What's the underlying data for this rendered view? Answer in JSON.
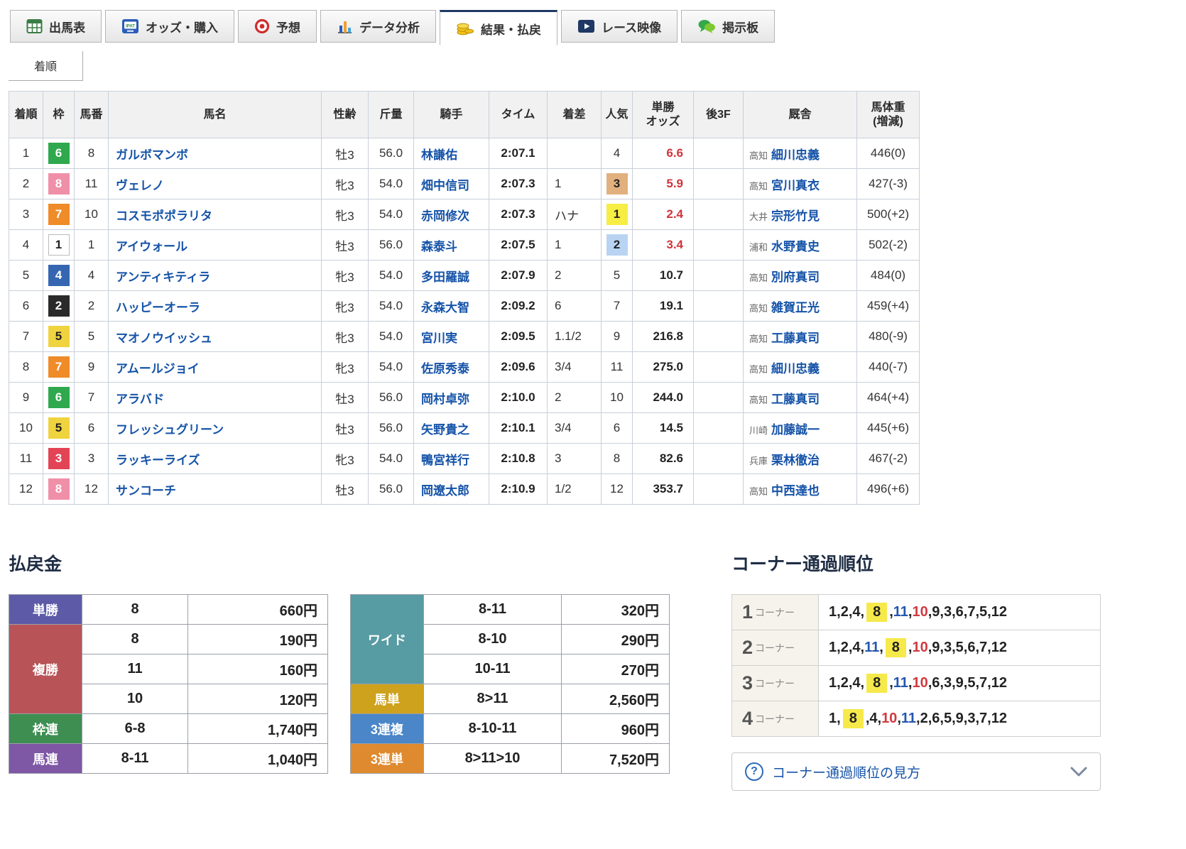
{
  "tabs": [
    {
      "id": "shutsubahyo",
      "label": "出馬表",
      "icon": "racecard-table-icon",
      "active": false
    },
    {
      "id": "odds",
      "label": "オッズ・購入",
      "icon": "ipat-odds-icon",
      "active": false
    },
    {
      "id": "yoso",
      "label": "予想",
      "icon": "prediction-target-icon",
      "active": false
    },
    {
      "id": "data",
      "label": "データ分析",
      "icon": "data-analysis-chart-icon",
      "active": false
    },
    {
      "id": "kekka",
      "label": "結果・払戻",
      "icon": "result-payout-coins-icon",
      "active": true
    },
    {
      "id": "video",
      "label": "レース映像",
      "icon": "race-video-icon",
      "active": false
    },
    {
      "id": "keijiban",
      "label": "掲示板",
      "icon": "bbs-comment-icon",
      "active": false
    }
  ],
  "subtab": {
    "label": "着順"
  },
  "results": {
    "headers": [
      "着順",
      "枠",
      "馬番",
      "馬名",
      "性齢",
      "斤量",
      "騎手",
      "タイム",
      "着差",
      "人気",
      "単勝\nオッズ",
      "後3F",
      "厩舎",
      "馬体重\n(増減)"
    ],
    "colors": {
      "frame": {
        "1": "#ffffff",
        "2": "#2b2b2b",
        "3": "#e24456",
        "4": "#3566b2",
        "5": "#efd33f",
        "6": "#2fa84e",
        "7": "#ef8b28",
        "8": "#f08fa8"
      },
      "pop": {
        "1": "#f6ee44",
        "2": "#b9d3f2",
        "3": "#e2b07e"
      },
      "odds_hot": "#d0343c",
      "link": "#1553a8"
    },
    "rows": [
      {
        "rank": "1",
        "frame": "6",
        "no": "8",
        "horse": "ガルボマンボ",
        "sex_age": "牡3",
        "weight": "56.0",
        "jockey": "林謙佑",
        "time": "2:07.1",
        "margin": "",
        "pop": "4",
        "odds": "6.6",
        "odds_hot": true,
        "last3f": "",
        "region": "高知",
        "trainer": "細川忠義",
        "horse_weight": "446(0)"
      },
      {
        "rank": "2",
        "frame": "8",
        "no": "11",
        "horse": "ヴェレノ",
        "sex_age": "牝3",
        "weight": "54.0",
        "jockey": "畑中信司",
        "time": "2:07.3",
        "margin": "1",
        "pop": "3",
        "odds": "5.9",
        "odds_hot": true,
        "last3f": "",
        "region": "高知",
        "trainer": "宮川真衣",
        "horse_weight": "427(-3)"
      },
      {
        "rank": "3",
        "frame": "7",
        "no": "10",
        "horse": "コスモポポラリタ",
        "sex_age": "牝3",
        "weight": "54.0",
        "jockey": "赤岡修次",
        "time": "2:07.3",
        "margin": "ハナ",
        "pop": "1",
        "odds": "2.4",
        "odds_hot": true,
        "last3f": "",
        "region": "大井",
        "trainer": "宗形竹見",
        "horse_weight": "500(+2)"
      },
      {
        "rank": "4",
        "frame": "1",
        "no": "1",
        "horse": "アイウォール",
        "sex_age": "牡3",
        "weight": "56.0",
        "jockey": "森泰斗",
        "time": "2:07.5",
        "margin": "1",
        "pop": "2",
        "odds": "3.4",
        "odds_hot": true,
        "last3f": "",
        "region": "浦和",
        "trainer": "水野貴史",
        "horse_weight": "502(-2)"
      },
      {
        "rank": "5",
        "frame": "4",
        "no": "4",
        "horse": "アンティキティラ",
        "sex_age": "牝3",
        "weight": "54.0",
        "jockey": "多田羅誠",
        "time": "2:07.9",
        "margin": "2",
        "pop": "5",
        "odds": "10.7",
        "odds_hot": false,
        "last3f": "",
        "region": "高知",
        "trainer": "別府真司",
        "horse_weight": "484(0)"
      },
      {
        "rank": "6",
        "frame": "2",
        "no": "2",
        "horse": "ハッピーオーラ",
        "sex_age": "牝3",
        "weight": "54.0",
        "jockey": "永森大智",
        "time": "2:09.2",
        "margin": "6",
        "pop": "7",
        "odds": "19.1",
        "odds_hot": false,
        "last3f": "",
        "region": "高知",
        "trainer": "雑賀正光",
        "horse_weight": "459(+4)"
      },
      {
        "rank": "7",
        "frame": "5",
        "no": "5",
        "horse": "マオノウイッシュ",
        "sex_age": "牝3",
        "weight": "54.0",
        "jockey": "宮川実",
        "time": "2:09.5",
        "margin": "1.1/2",
        "pop": "9",
        "odds": "216.8",
        "odds_hot": false,
        "last3f": "",
        "region": "高知",
        "trainer": "工藤真司",
        "horse_weight": "480(-9)"
      },
      {
        "rank": "8",
        "frame": "7",
        "no": "9",
        "horse": "アムールジョイ",
        "sex_age": "牝3",
        "weight": "54.0",
        "jockey": "佐原秀泰",
        "time": "2:09.6",
        "margin": "3/4",
        "pop": "11",
        "odds": "275.0",
        "odds_hot": false,
        "last3f": "",
        "region": "高知",
        "trainer": "細川忠義",
        "horse_weight": "440(-7)"
      },
      {
        "rank": "9",
        "frame": "6",
        "no": "7",
        "horse": "アラバド",
        "sex_age": "牡3",
        "weight": "56.0",
        "jockey": "岡村卓弥",
        "time": "2:10.0",
        "margin": "2",
        "pop": "10",
        "odds": "244.0",
        "odds_hot": false,
        "last3f": "",
        "region": "高知",
        "trainer": "工藤真司",
        "horse_weight": "464(+4)"
      },
      {
        "rank": "10",
        "frame": "5",
        "no": "6",
        "horse": "フレッシュグリーン",
        "sex_age": "牡3",
        "weight": "56.0",
        "jockey": "矢野貴之",
        "time": "2:10.1",
        "margin": "3/4",
        "pop": "6",
        "odds": "14.5",
        "odds_hot": false,
        "last3f": "",
        "region": "川崎",
        "trainer": "加藤誠一",
        "horse_weight": "445(+6)"
      },
      {
        "rank": "11",
        "frame": "3",
        "no": "3",
        "horse": "ラッキーライズ",
        "sex_age": "牝3",
        "weight": "54.0",
        "jockey": "鴨宮祥行",
        "time": "2:10.8",
        "margin": "3",
        "pop": "8",
        "odds": "82.6",
        "odds_hot": false,
        "last3f": "",
        "region": "兵庫",
        "trainer": "栗林徹治",
        "horse_weight": "467(-2)"
      },
      {
        "rank": "12",
        "frame": "8",
        "no": "12",
        "horse": "サンコーチ",
        "sex_age": "牡3",
        "weight": "56.0",
        "jockey": "岡遼太郎",
        "time": "2:10.9",
        "margin": "1/2",
        "pop": "12",
        "odds": "353.7",
        "odds_hot": false,
        "last3f": "",
        "region": "高知",
        "trainer": "中西達也",
        "horse_weight": "496(+6)"
      }
    ]
  },
  "payout": {
    "title": "払戻金",
    "left": [
      {
        "label": "単勝",
        "color": "#5d5ba8",
        "rows": [
          {
            "combo": "8",
            "amount": "660円"
          }
        ]
      },
      {
        "label": "複勝",
        "color": "#b85458",
        "rows": [
          {
            "combo": "8",
            "amount": "190円"
          },
          {
            "combo": "11",
            "amount": "160円"
          },
          {
            "combo": "10",
            "amount": "120円"
          }
        ]
      },
      {
        "label": "枠連",
        "color": "#3e8e52",
        "rows": [
          {
            "combo": "6-8",
            "amount": "1,740円"
          }
        ]
      },
      {
        "label": "馬連",
        "color": "#7e57a5",
        "rows": [
          {
            "combo": "8-11",
            "amount": "1,040円"
          }
        ]
      }
    ],
    "right": [
      {
        "label": "ワイド",
        "color": "#579ba3",
        "rows": [
          {
            "combo": "8-11",
            "amount": "320円"
          },
          {
            "combo": "8-10",
            "amount": "290円"
          },
          {
            "combo": "10-11",
            "amount": "270円"
          }
        ]
      },
      {
        "label": "馬単",
        "color": "#cfa21d",
        "rows": [
          {
            "combo": "8>11",
            "amount": "2,560円"
          }
        ]
      },
      {
        "label": "3連複",
        "color": "#4a86c8",
        "rows": [
          {
            "combo": "8-10-11",
            "amount": "960円"
          }
        ]
      },
      {
        "label": "3連単",
        "color": "#df8a2e",
        "rows": [
          {
            "combo": "8>11>10",
            "amount": "7,520円"
          }
        ]
      }
    ]
  },
  "corner": {
    "title": "コーナー通過順位",
    "first": "8",
    "second": "11",
    "third": "10",
    "colors": {
      "first_bg": "#f6e94a",
      "second": "#2456b0",
      "third": "#d03a40"
    },
    "corners": [
      {
        "num": "1",
        "suffix": "コーナー",
        "order": [
          "1",
          "2",
          "4",
          "8",
          "11",
          "10",
          "9",
          "3",
          "6",
          "7",
          "5",
          "12"
        ]
      },
      {
        "num": "2",
        "suffix": "コーナー",
        "order": [
          "1",
          "2",
          "4",
          "11",
          "8",
          "10",
          "9",
          "3",
          "5",
          "6",
          "7",
          "12"
        ]
      },
      {
        "num": "3",
        "suffix": "コーナー",
        "order": [
          "1",
          "2",
          "4",
          "8",
          "11",
          "10",
          "6",
          "3",
          "9",
          "5",
          "7",
          "12"
        ]
      },
      {
        "num": "4",
        "suffix": "コーナー",
        "order": [
          "1",
          "8",
          "4",
          "10",
          "11",
          "2",
          "6",
          "5",
          "9",
          "3",
          "7",
          "12"
        ]
      }
    ],
    "help": {
      "icon_text": "?",
      "label": "コーナー通過順位の見方"
    }
  }
}
